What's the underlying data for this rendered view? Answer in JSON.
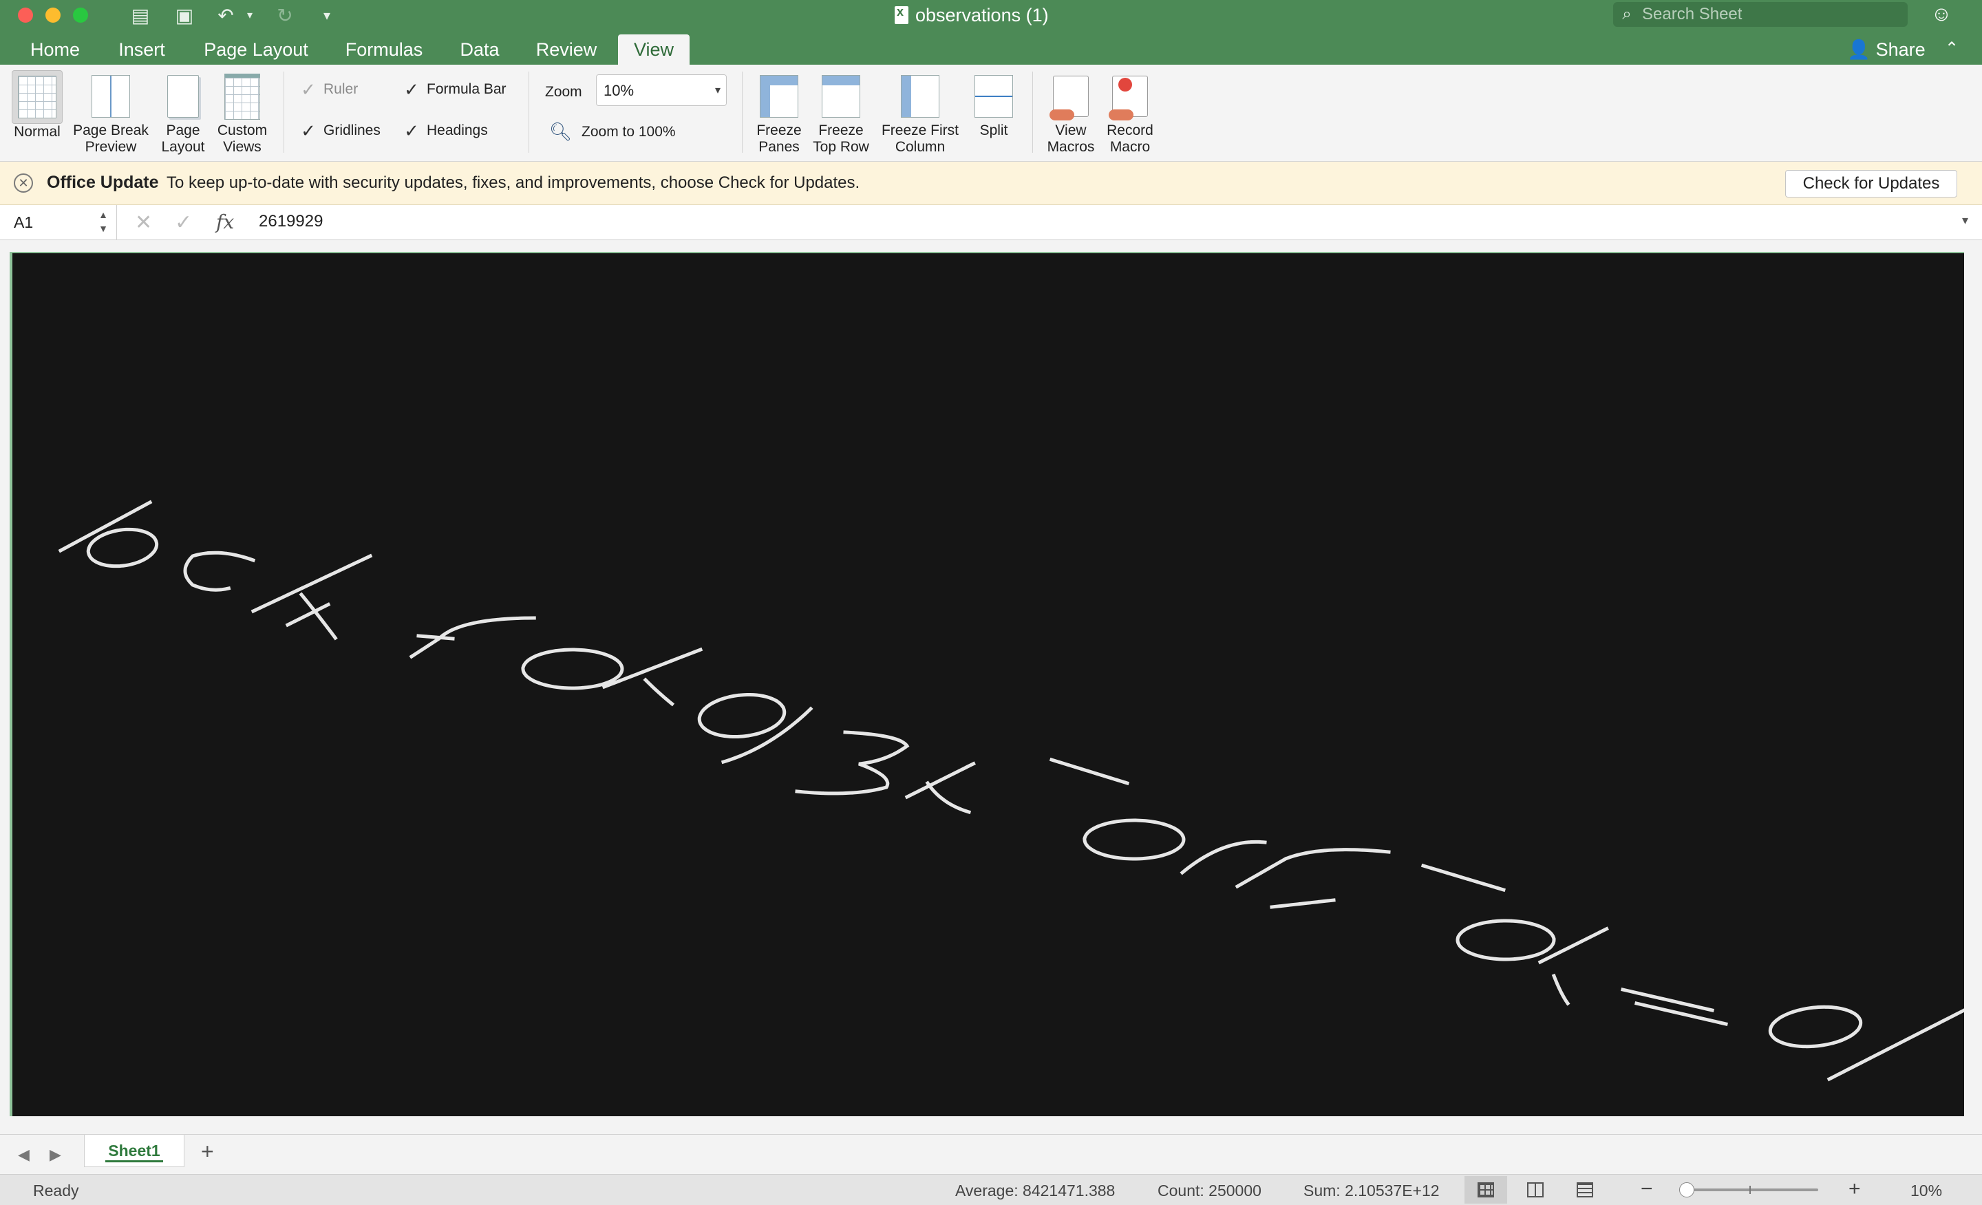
{
  "window": {
    "title": "observations (1)",
    "search_placeholder": "Search Sheet"
  },
  "colors": {
    "ribbon_green": "#4c8a56",
    "accent_green": "#2f7a3d",
    "canvas_black": "#151515",
    "message_bg": "#fdf4dc"
  },
  "tabs": [
    {
      "label": "Home"
    },
    {
      "label": "Insert"
    },
    {
      "label": "Page Layout"
    },
    {
      "label": "Formulas"
    },
    {
      "label": "Data"
    },
    {
      "label": "Review"
    },
    {
      "label": "View",
      "active": true
    }
  ],
  "share_label": "Share",
  "ribbon": {
    "normal": "Normal",
    "page_break_1": "Page Break",
    "page_break_2": "Preview",
    "page_layout_1": "Page",
    "page_layout_2": "Layout",
    "custom_views_1": "Custom",
    "custom_views_2": "Views",
    "ruler": "Ruler",
    "formula_bar": "Formula Bar",
    "gridlines": "Gridlines",
    "headings": "Headings",
    "zoom_label": "Zoom",
    "zoom_value": "10%",
    "zoom_100": "Zoom to 100%",
    "freeze_panes_1": "Freeze",
    "freeze_panes_2": "Panes",
    "freeze_top_1": "Freeze",
    "freeze_top_2": "Top Row",
    "freeze_col_1": "Freeze First",
    "freeze_col_2": "Column",
    "split": "Split",
    "view_macros_1": "View",
    "view_macros_2": "Macros",
    "record_macro_1": "Record",
    "record_macro_2": "Macro"
  },
  "message": {
    "title": "Office Update",
    "text": "To keep up-to-date with security updates, fixes, and improvements, choose Check for Updates.",
    "button": "Check for Updates"
  },
  "formula": {
    "cell": "A1",
    "fx": "fx",
    "value": "2619929"
  },
  "sheet": {
    "tab": "Sheet1"
  },
  "status": {
    "ready": "Ready",
    "average": "Average: 8421471.388",
    "count": "Count: 250000",
    "sum": "Sum: 2.10537E+12",
    "zoom": "10%"
  }
}
